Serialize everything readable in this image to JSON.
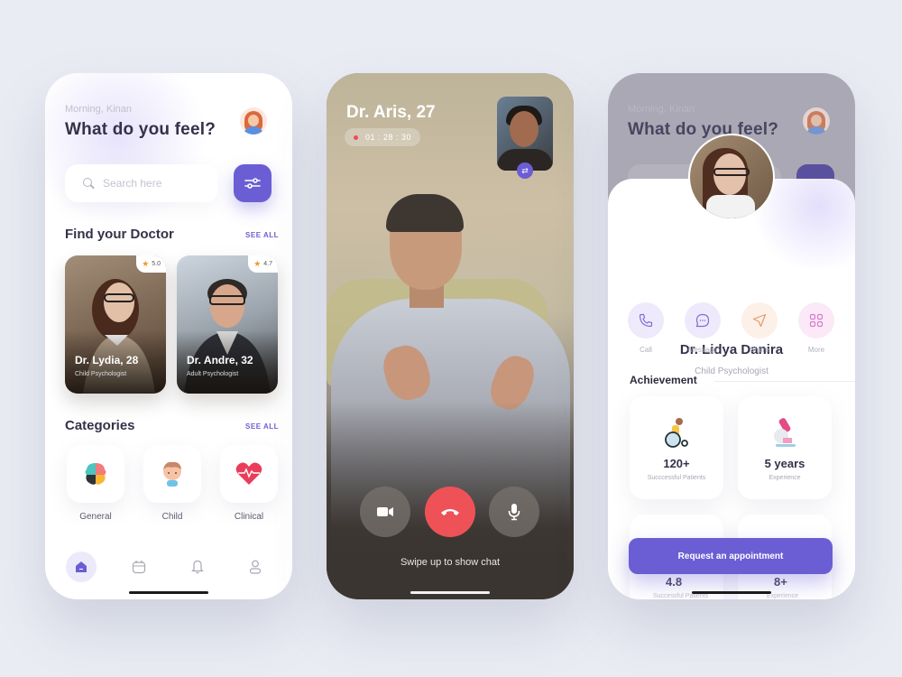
{
  "home": {
    "greeting": "Morning, Kinan",
    "headline": "What do you feel?",
    "search": {
      "placeholder": "Search here",
      "value": ""
    },
    "doctors_section": {
      "title": "Find your Doctor",
      "see_all": "SEE ALL"
    },
    "doctors": [
      {
        "name": "Dr. Lydia, 28",
        "specialty": "Child Psychologist",
        "rating": "5.0"
      },
      {
        "name": "Dr. Andre, 32",
        "specialty": "Adult Psychologist",
        "rating": "4.7"
      }
    ],
    "categories_section": {
      "title": "Categories",
      "see_all": "SEE ALL"
    },
    "categories": [
      {
        "label": "General",
        "icon": "brain-icon"
      },
      {
        "label": "Child",
        "icon": "child-icon"
      },
      {
        "label": "Clinical",
        "icon": "heart-pulse-icon"
      }
    ],
    "bottom_nav": [
      {
        "name": "home",
        "icon": "home-icon",
        "active": true
      },
      {
        "name": "calendar",
        "icon": "calendar-icon",
        "active": false
      },
      {
        "name": "notifications",
        "icon": "bell-icon",
        "active": false
      },
      {
        "name": "profile",
        "icon": "user-icon",
        "active": false
      }
    ]
  },
  "call": {
    "caller_name": "Dr. Aris, 27",
    "timer": "01 : 28 : 30",
    "swipe_hint": "Swipe up to show chat",
    "buttons": [
      {
        "name": "video",
        "icon": "video-camera-icon"
      },
      {
        "name": "end-call",
        "icon": "phone-hangup-icon"
      },
      {
        "name": "mute",
        "icon": "microphone-icon"
      }
    ]
  },
  "profile": {
    "background": {
      "greeting": "Morning, Kinan",
      "headline": "What do you feel?"
    },
    "name": "Dr. Lidya Danira",
    "specialty": "Child Psychologist",
    "actions": [
      {
        "label": "Call",
        "icon": "phone-icon",
        "bg": "#eeeafb",
        "fg": "#7d6fd6"
      },
      {
        "label": "Message",
        "icon": "chat-bubble-icon",
        "bg": "#eeeafb",
        "fg": "#7d6fd6"
      },
      {
        "label": "Share",
        "icon": "send-icon",
        "bg": "#fdf0e8",
        "fg": "#e39b6b"
      },
      {
        "label": "More",
        "icon": "grid-icon",
        "bg": "#fbe9f7",
        "fg": "#d77bd0"
      }
    ],
    "achievement_title": "Achievement",
    "achievements": [
      {
        "value": "120+",
        "caption": "Succcessful Patients",
        "icon": "wheelchair-icon"
      },
      {
        "value": "5 years",
        "caption": "Experience",
        "icon": "microscope-icon"
      },
      {
        "value": "4.8",
        "caption": "Successful Patients",
        "icon": ""
      },
      {
        "value": "8+",
        "caption": "Experience",
        "icon": ""
      }
    ],
    "request_button": "Request an appointment"
  },
  "colors": {
    "accent": "#6b5ed4",
    "end_call": "#ee5257",
    "star": "#f09a2a",
    "background": "#e9ecf3"
  }
}
